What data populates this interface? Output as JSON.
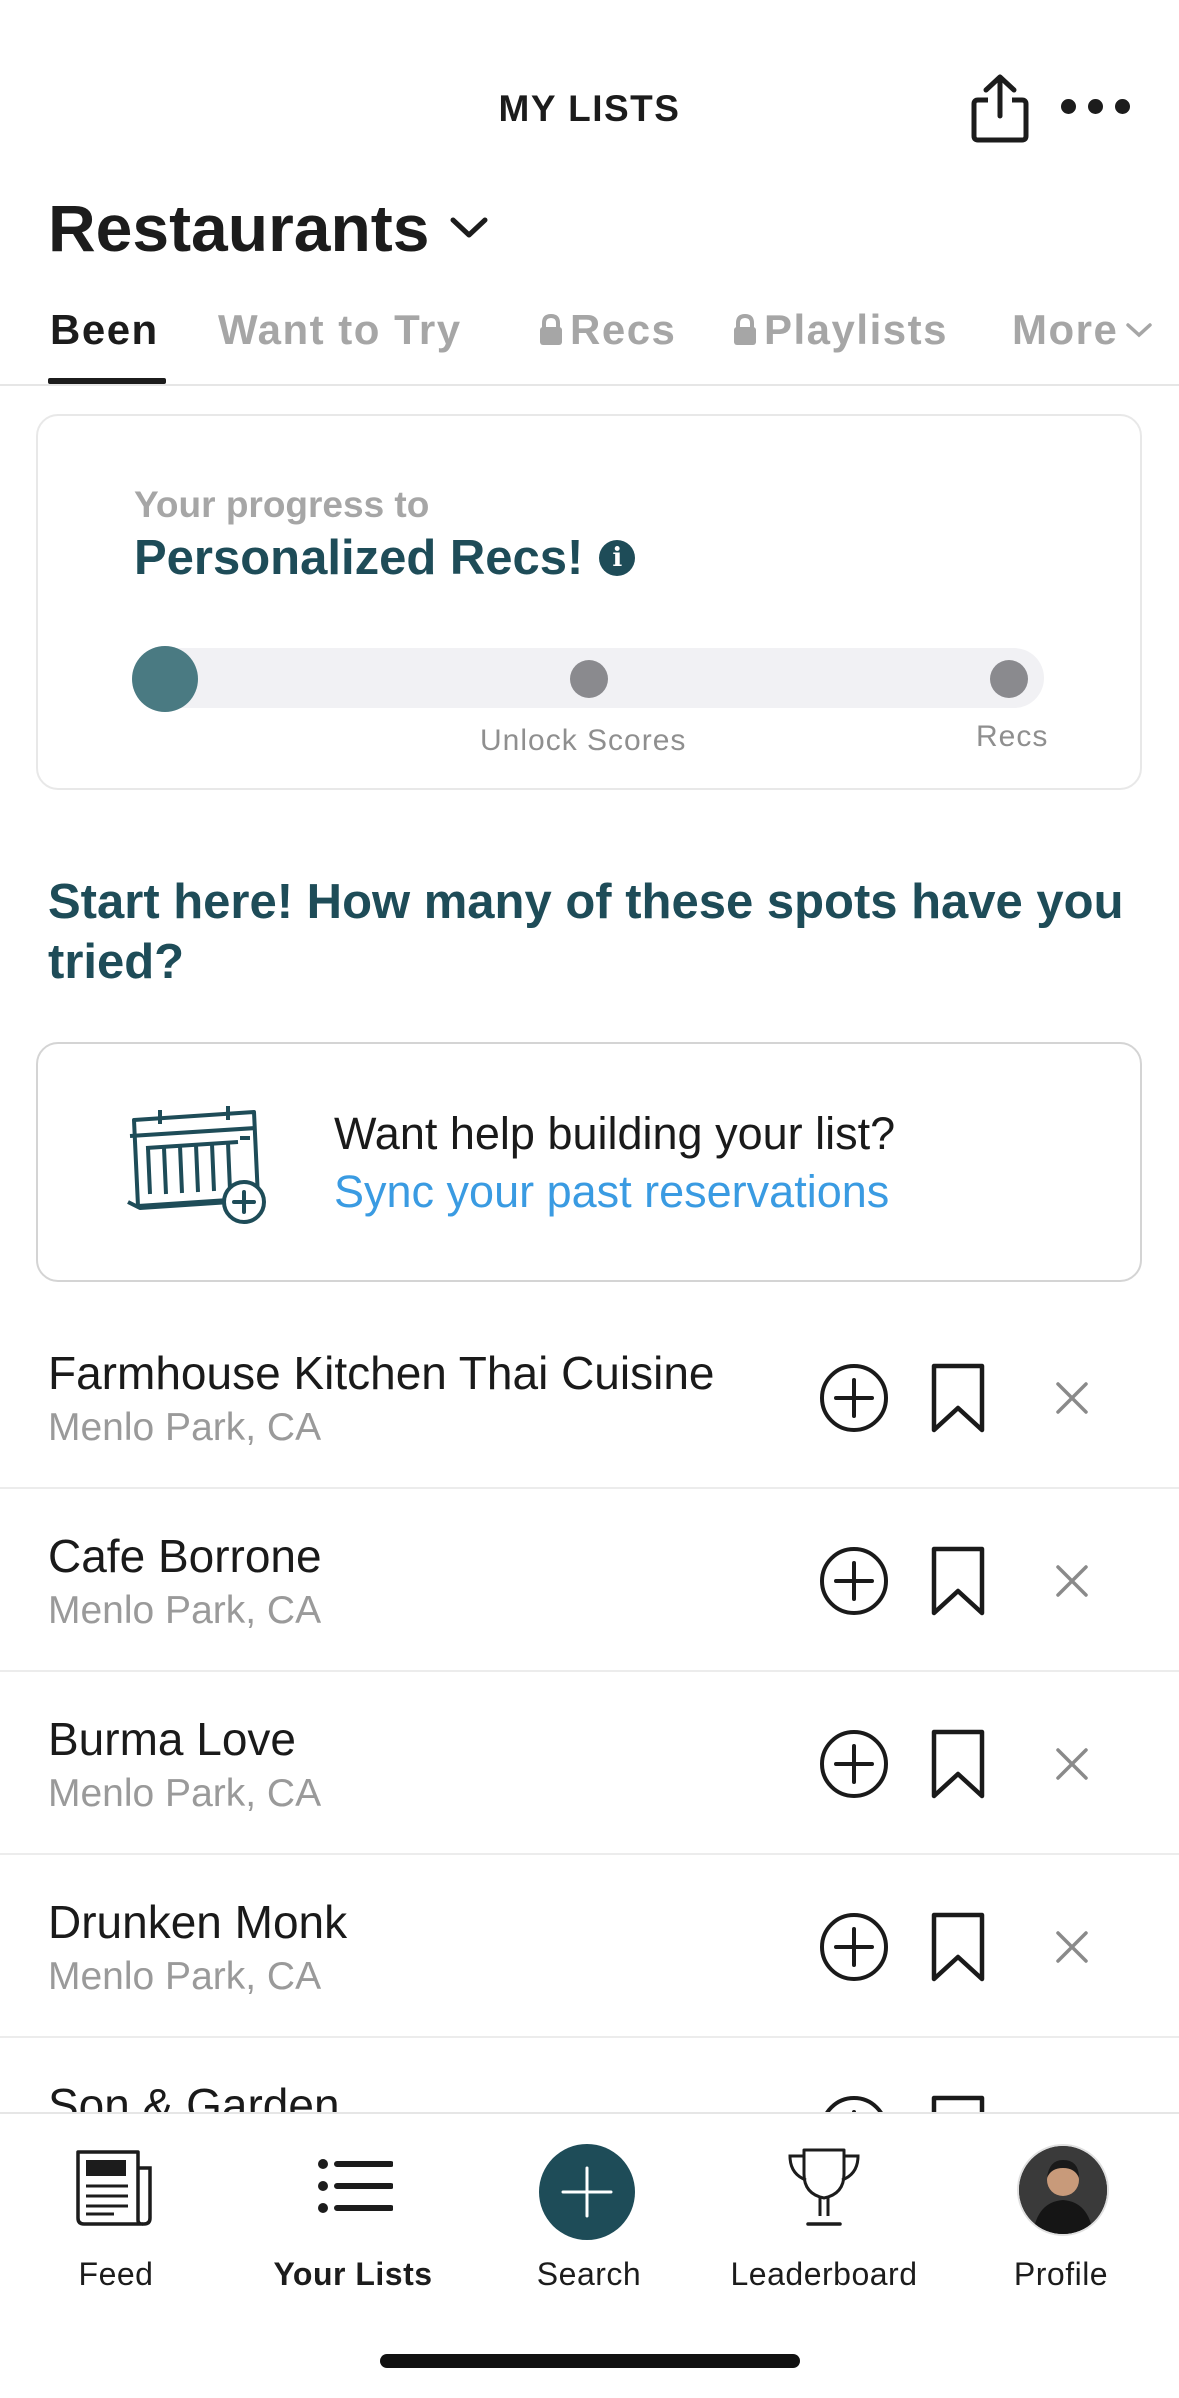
{
  "header": {
    "title": "MY LISTS"
  },
  "list_selector": {
    "name": "Restaurants"
  },
  "tabs": [
    {
      "label": "Been",
      "locked": false,
      "active": true
    },
    {
      "label": "Want to Try",
      "locked": false,
      "active": false
    },
    {
      "label": "Recs",
      "locked": true,
      "active": false
    },
    {
      "label": "Playlists",
      "locked": true,
      "active": false
    },
    {
      "label": "More",
      "locked": false,
      "active": false
    }
  ],
  "progress": {
    "label": "Your progress to",
    "title": "Personalized Recs!",
    "milestones": [
      "Unlock Scores",
      "Recs"
    ],
    "current_step": 0
  },
  "prompt": {
    "text": "Start here! How many of these spots have you tried?"
  },
  "sync": {
    "question": "Want help building your list?",
    "link": "Sync your past reservations"
  },
  "restaurants": [
    {
      "name": "Farmhouse Kitchen Thai Cuisine",
      "location": "Menlo Park, CA"
    },
    {
      "name": "Cafe Borrone",
      "location": "Menlo Park, CA"
    },
    {
      "name": "Burma Love",
      "location": "Menlo Park, CA"
    },
    {
      "name": "Drunken Monk",
      "location": "Menlo Park, CA"
    },
    {
      "name": "Son & Garden",
      "location": ""
    }
  ],
  "bottom_nav": [
    {
      "label": "Feed",
      "icon": "newspaper-icon",
      "active": false
    },
    {
      "label": "Your Lists",
      "icon": "list-icon",
      "active": true
    },
    {
      "label": "Search",
      "icon": "plus-icon",
      "active": false
    },
    {
      "label": "Leaderboard",
      "icon": "trophy-icon",
      "active": false
    },
    {
      "label": "Profile",
      "icon": "avatar",
      "active": false
    }
  ],
  "colors": {
    "primary": "#1e4c58",
    "link": "#3a9be2",
    "progress_fill": "#4a7a82",
    "muted": "#a6a6a6"
  }
}
